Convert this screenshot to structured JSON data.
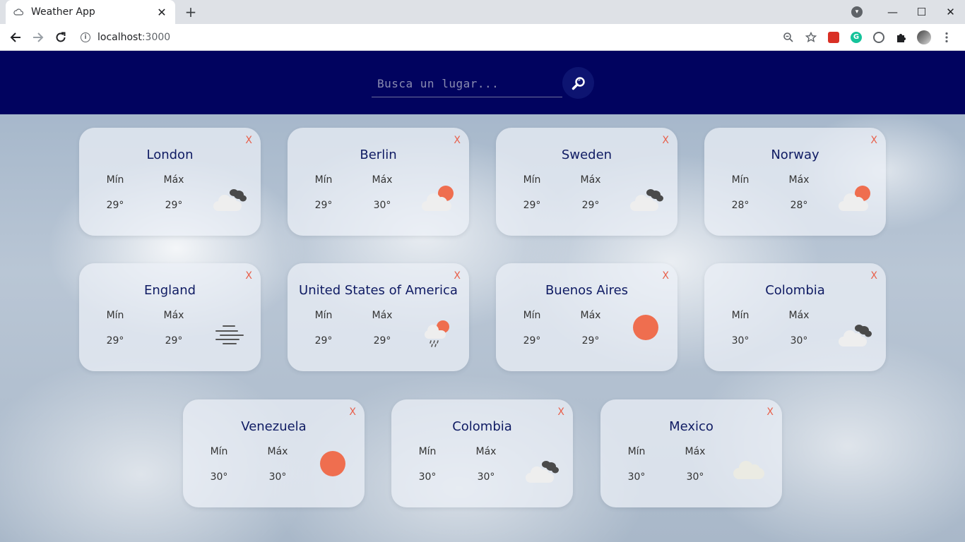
{
  "browser": {
    "tab_title": "Weather App",
    "url_host": "localhost",
    "url_port": ":3000",
    "tab_close": "✕",
    "new_tab": "+"
  },
  "search": {
    "placeholder": "Busca un lugar..."
  },
  "labels": {
    "min": "Mín",
    "max": "Máx",
    "close": "X"
  },
  "cards": [
    {
      "name": "London",
      "min": "29°",
      "max": "29°",
      "icon": "cloudy-night-icon"
    },
    {
      "name": "Berlin",
      "min": "29°",
      "max": "30°",
      "icon": "partly-cloudy-icon"
    },
    {
      "name": "Sweden",
      "min": "29°",
      "max": "29°",
      "icon": "cloudy-night-icon"
    },
    {
      "name": "Norway",
      "min": "28°",
      "max": "28°",
      "icon": "partly-cloudy-icon"
    },
    {
      "name": "England",
      "min": "29°",
      "max": "29°",
      "icon": "fog-icon"
    },
    {
      "name": "United States of America",
      "min": "29°",
      "max": "29°",
      "icon": "sun-rain-icon"
    },
    {
      "name": "Buenos Aires",
      "min": "29°",
      "max": "29°",
      "icon": "sun-icon"
    },
    {
      "name": "Colombia",
      "min": "30°",
      "max": "30°",
      "icon": "cloudy-night-icon"
    },
    {
      "name": "Venezuela",
      "min": "30°",
      "max": "30°",
      "icon": "sun-icon"
    },
    {
      "name": "Colombia",
      "min": "30°",
      "max": "30°",
      "icon": "cloudy-night-icon"
    },
    {
      "name": "Mexico",
      "min": "30°",
      "max": "30°",
      "icon": "cloud-icon"
    }
  ],
  "colors": {
    "header": "#01035f",
    "sun": "#ef6e4f",
    "city_name": "#0f1b63",
    "close": "#e8604b"
  }
}
